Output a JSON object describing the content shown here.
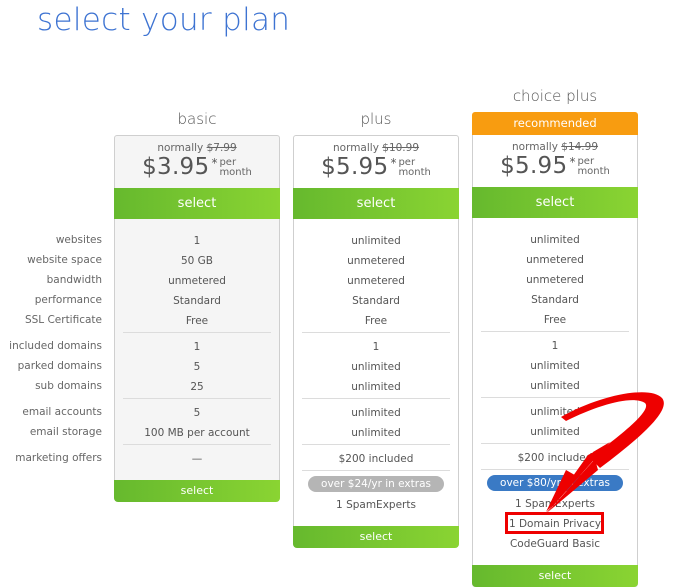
{
  "page_title": "select your plan",
  "feature_labels": [
    "websites",
    "website space",
    "bandwidth",
    "performance",
    "SSL Certificate",
    "included domains",
    "parked domains",
    "sub domains",
    "email accounts",
    "email storage",
    "marketing offers"
  ],
  "plans": [
    {
      "name": "basic",
      "normally_label": "normally",
      "old_price": "$7.99",
      "price": "$3.95",
      "asterisk": "*",
      "per": "per",
      "month": "month",
      "select_label": "select",
      "features": [
        "1",
        "50 GB",
        "unmetered",
        "Standard",
        "Free",
        "1",
        "5",
        "25",
        "5",
        "100 MB per account",
        "—"
      ],
      "bottom_select_label": "select"
    },
    {
      "name": "plus",
      "normally_label": "normally",
      "old_price": "$10.99",
      "price": "$5.95",
      "asterisk": "*",
      "per": "per",
      "month": "month",
      "select_label": "select",
      "features": [
        "unlimited",
        "unmetered",
        "unmetered",
        "Standard",
        "Free",
        "1",
        "unlimited",
        "unlimited",
        "unlimited",
        "unlimited",
        "$200 included"
      ],
      "extras_badge": "over $24/yr in extras",
      "extras": [
        "1 SpamExperts"
      ],
      "bottom_select_label": "select"
    },
    {
      "name": "choice plus",
      "ribbon": "recommended",
      "normally_label": "normally",
      "old_price": "$14.99",
      "price": "$5.95",
      "asterisk": "*",
      "per": "per",
      "month": "month",
      "select_label": "select",
      "features": [
        "unlimited",
        "unmetered",
        "unmetered",
        "Standard",
        "Free",
        "1",
        "unlimited",
        "unlimited",
        "unlimited",
        "unlimited",
        "$200 included"
      ],
      "extras_badge": "over $80/yr in extras",
      "extras": [
        "1 SpamExperts",
        "1 Domain Privacy",
        "CodeGuard Basic"
      ],
      "bottom_select_label": "select"
    }
  ],
  "colors": {
    "title": "#3d73d2",
    "select_green": "#76c52f",
    "recommended_orange": "#f89c10",
    "badge_gray": "#b5b5b5",
    "badge_blue": "#3a7ac5",
    "annotation_red": "#ee0000"
  }
}
